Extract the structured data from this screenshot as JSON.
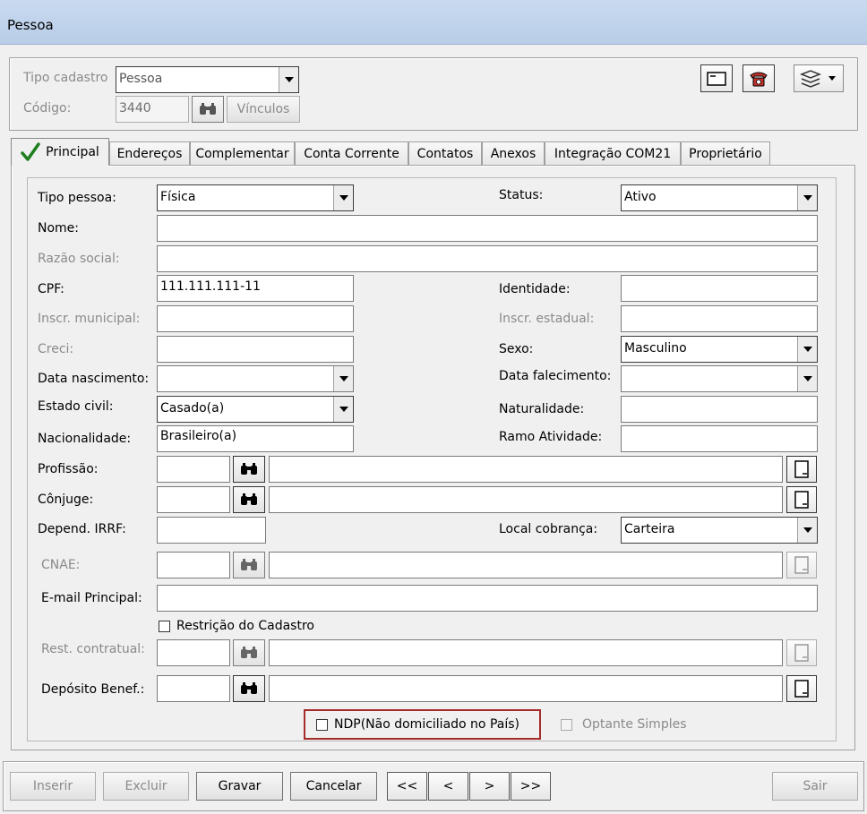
{
  "window": {
    "title": "Pessoa"
  },
  "header": {
    "tipo_cadastro_label": "Tipo cadastro",
    "tipo_cadastro_value": "Pessoa",
    "codigo_label": "Código:",
    "codigo_value": "3440",
    "vinculos_label": "Vínculos"
  },
  "tabs": [
    {
      "label": "Principal"
    },
    {
      "label": "Endereços"
    },
    {
      "label": "Complementar"
    },
    {
      "label": "Conta Corrente"
    },
    {
      "label": "Contatos"
    },
    {
      "label": "Anexos"
    },
    {
      "label": "Integração COM21"
    },
    {
      "label": "Proprietário"
    }
  ],
  "form": {
    "tipo_pessoa": {
      "label": "Tipo pessoa:",
      "value": "Física"
    },
    "status": {
      "label": "Status:",
      "value": "Ativo"
    },
    "nome": {
      "label": "Nome:",
      "value": ""
    },
    "razao_social": {
      "label": "Razão social:",
      "value": ""
    },
    "cpf": {
      "label": "CPF:",
      "value": "111.111.111-11"
    },
    "identidade": {
      "label": "Identidade:",
      "value": ""
    },
    "inscr_municipal": {
      "label": "Inscr. municipal:",
      "value": ""
    },
    "inscr_estadual": {
      "label": "Inscr. estadual:",
      "value": ""
    },
    "creci": {
      "label": "Creci:",
      "value": ""
    },
    "sexo": {
      "label": "Sexo:",
      "value": "Masculino"
    },
    "data_nascimento": {
      "label": "Data nascimento:",
      "value": ""
    },
    "data_falecimento": {
      "label": "Data falecimento:",
      "value": ""
    },
    "estado_civil": {
      "label": "Estado civil:",
      "value": "Casado(a)"
    },
    "naturalidade": {
      "label": "Naturalidade:",
      "value": ""
    },
    "nacionalidade": {
      "label": "Nacionalidade:",
      "value": "Brasileiro(a)"
    },
    "ramo_atividade": {
      "label": "Ramo Atividade:",
      "value": ""
    },
    "profissao": {
      "label": "Profissão:"
    },
    "conjuge": {
      "label": "Cônjuge:"
    },
    "depend_irrf": {
      "label": "Depend. IRRF:",
      "value": ""
    },
    "local_cobranca": {
      "label": "Local cobrança:",
      "value": "Carteira"
    },
    "cnae": {
      "label": "CNAE:"
    },
    "email_principal": {
      "label": "E-mail Principal:",
      "value": ""
    },
    "restricao_cadastro": {
      "label": "Restrição do Cadastro"
    },
    "rest_contratual": {
      "label": "Rest. contratual:"
    },
    "deposito_benef": {
      "label": "Depósito Benef.:"
    },
    "ndp": {
      "label": "NDP(Não domiciliado no País)"
    },
    "optante_simples": {
      "label": "Optante Simples"
    }
  },
  "footer": {
    "inserir": "Inserir",
    "excluir": "Excluir",
    "gravar": "Gravar",
    "cancelar": "Cancelar",
    "first": "<<",
    "prev": "<",
    "next": ">",
    "last": ">>",
    "sair": "Sair"
  },
  "colors": {
    "highlight_border": "#a52a2a",
    "check": "#1e7e1e"
  }
}
